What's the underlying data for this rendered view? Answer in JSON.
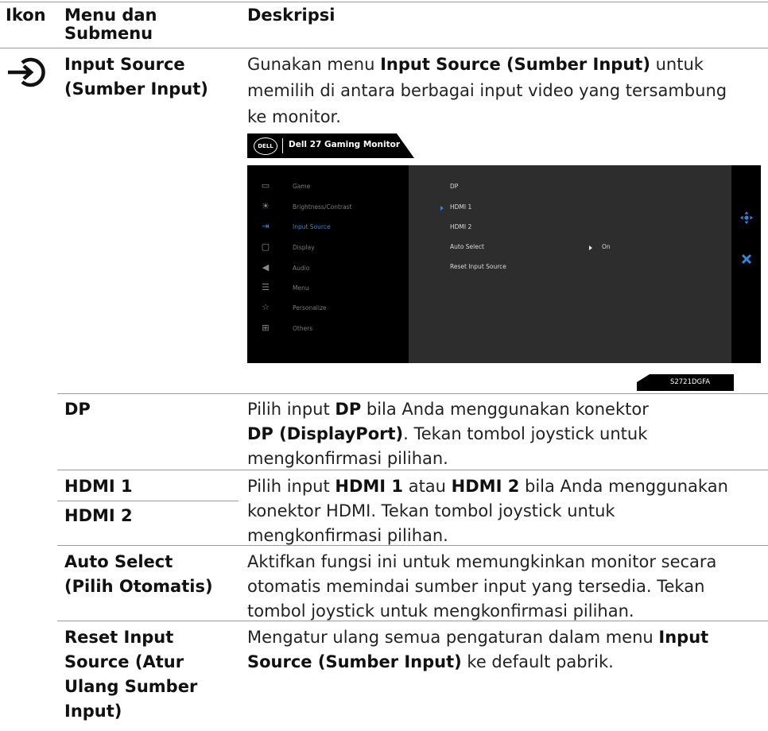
{
  "headers": {
    "col1": "Ikon",
    "col2_line1": "Menu dan",
    "col2_line2": "Submenu",
    "col3": "Deskripsi"
  },
  "main_row": {
    "icon": "input-source-icon",
    "menu_line1": "Input Source",
    "menu_line2": "(Sumber Input)",
    "desc": {
      "l1a": "Gunakan menu ",
      "l1b": "Input Source (Sumber Input)",
      "l1c": " untuk",
      "l2": "memilih di antara berbagai input video yang tersambung",
      "l3": "ke monitor."
    }
  },
  "osd": {
    "logo": "DELL",
    "title": "Dell 27 Gaming Monitor",
    "menu_items": [
      {
        "label": "Game",
        "icon": "game-icon"
      },
      {
        "label": "Brightness/Contrast",
        "icon": "brightness-icon"
      },
      {
        "label": "Input Source",
        "icon": "input-source-icon",
        "active": true
      },
      {
        "label": "Display",
        "icon": "display-icon"
      },
      {
        "label": "Audio",
        "icon": "audio-icon"
      },
      {
        "label": "Menu",
        "icon": "menu-icon"
      },
      {
        "label": "Personalize",
        "icon": "star-icon"
      },
      {
        "label": "Others",
        "icon": "others-icon"
      }
    ],
    "options": [
      "DP",
      "HDMI 1",
      "HDMI 2",
      "Auto Select",
      "Reset Input Source"
    ],
    "selected_option": "HDMI 1",
    "auto_select_value": "On",
    "side_icons": [
      "joystick-move-icon",
      "close-icon"
    ],
    "model": "S2721DGFA",
    "accent": "#2f86dd"
  },
  "rows": {
    "dp": {
      "menu": "DP",
      "l1a": "Pilih input ",
      "l1b": "DP",
      "l1c": " bila Anda menggunakan konektor",
      "l2a": "DP (DisplayPort)",
      "l2b": ". Tekan tombol joystick untuk",
      "l3": "mengkonfirmasi pilihan."
    },
    "hdmi": {
      "menu1": "HDMI 1",
      "menu2": "HDMI 2",
      "l1a": "Pilih input ",
      "l1b": "HDMI 1",
      "l1c": " atau ",
      "l1d": "HDMI 2",
      "l1e": " bila Anda menggunakan",
      "l2": "konektor HDMI. Tekan tombol joystick untuk",
      "l3": "mengkonfirmasi pilihan."
    },
    "auto": {
      "menu1": "Auto Select",
      "menu2": "(Pilih Otomatis)",
      "l1": "Aktifkan fungsi ini untuk memungkinkan monitor secara",
      "l2": "otomatis memindai sumber input yang tersedia. Tekan",
      "l3": "tombol joystick untuk mengkonfirmasi pilihan."
    },
    "reset": {
      "menu1": "Reset Input",
      "menu2": "Source (Atur",
      "menu3": "Ulang Sumber",
      "menu4": "Input)",
      "l1a": "Mengatur ulang semua pengaturan dalam menu ",
      "l1b": "Input",
      "l2a": "Source (Sumber Input)",
      "l2b": " ke default pabrik."
    }
  }
}
